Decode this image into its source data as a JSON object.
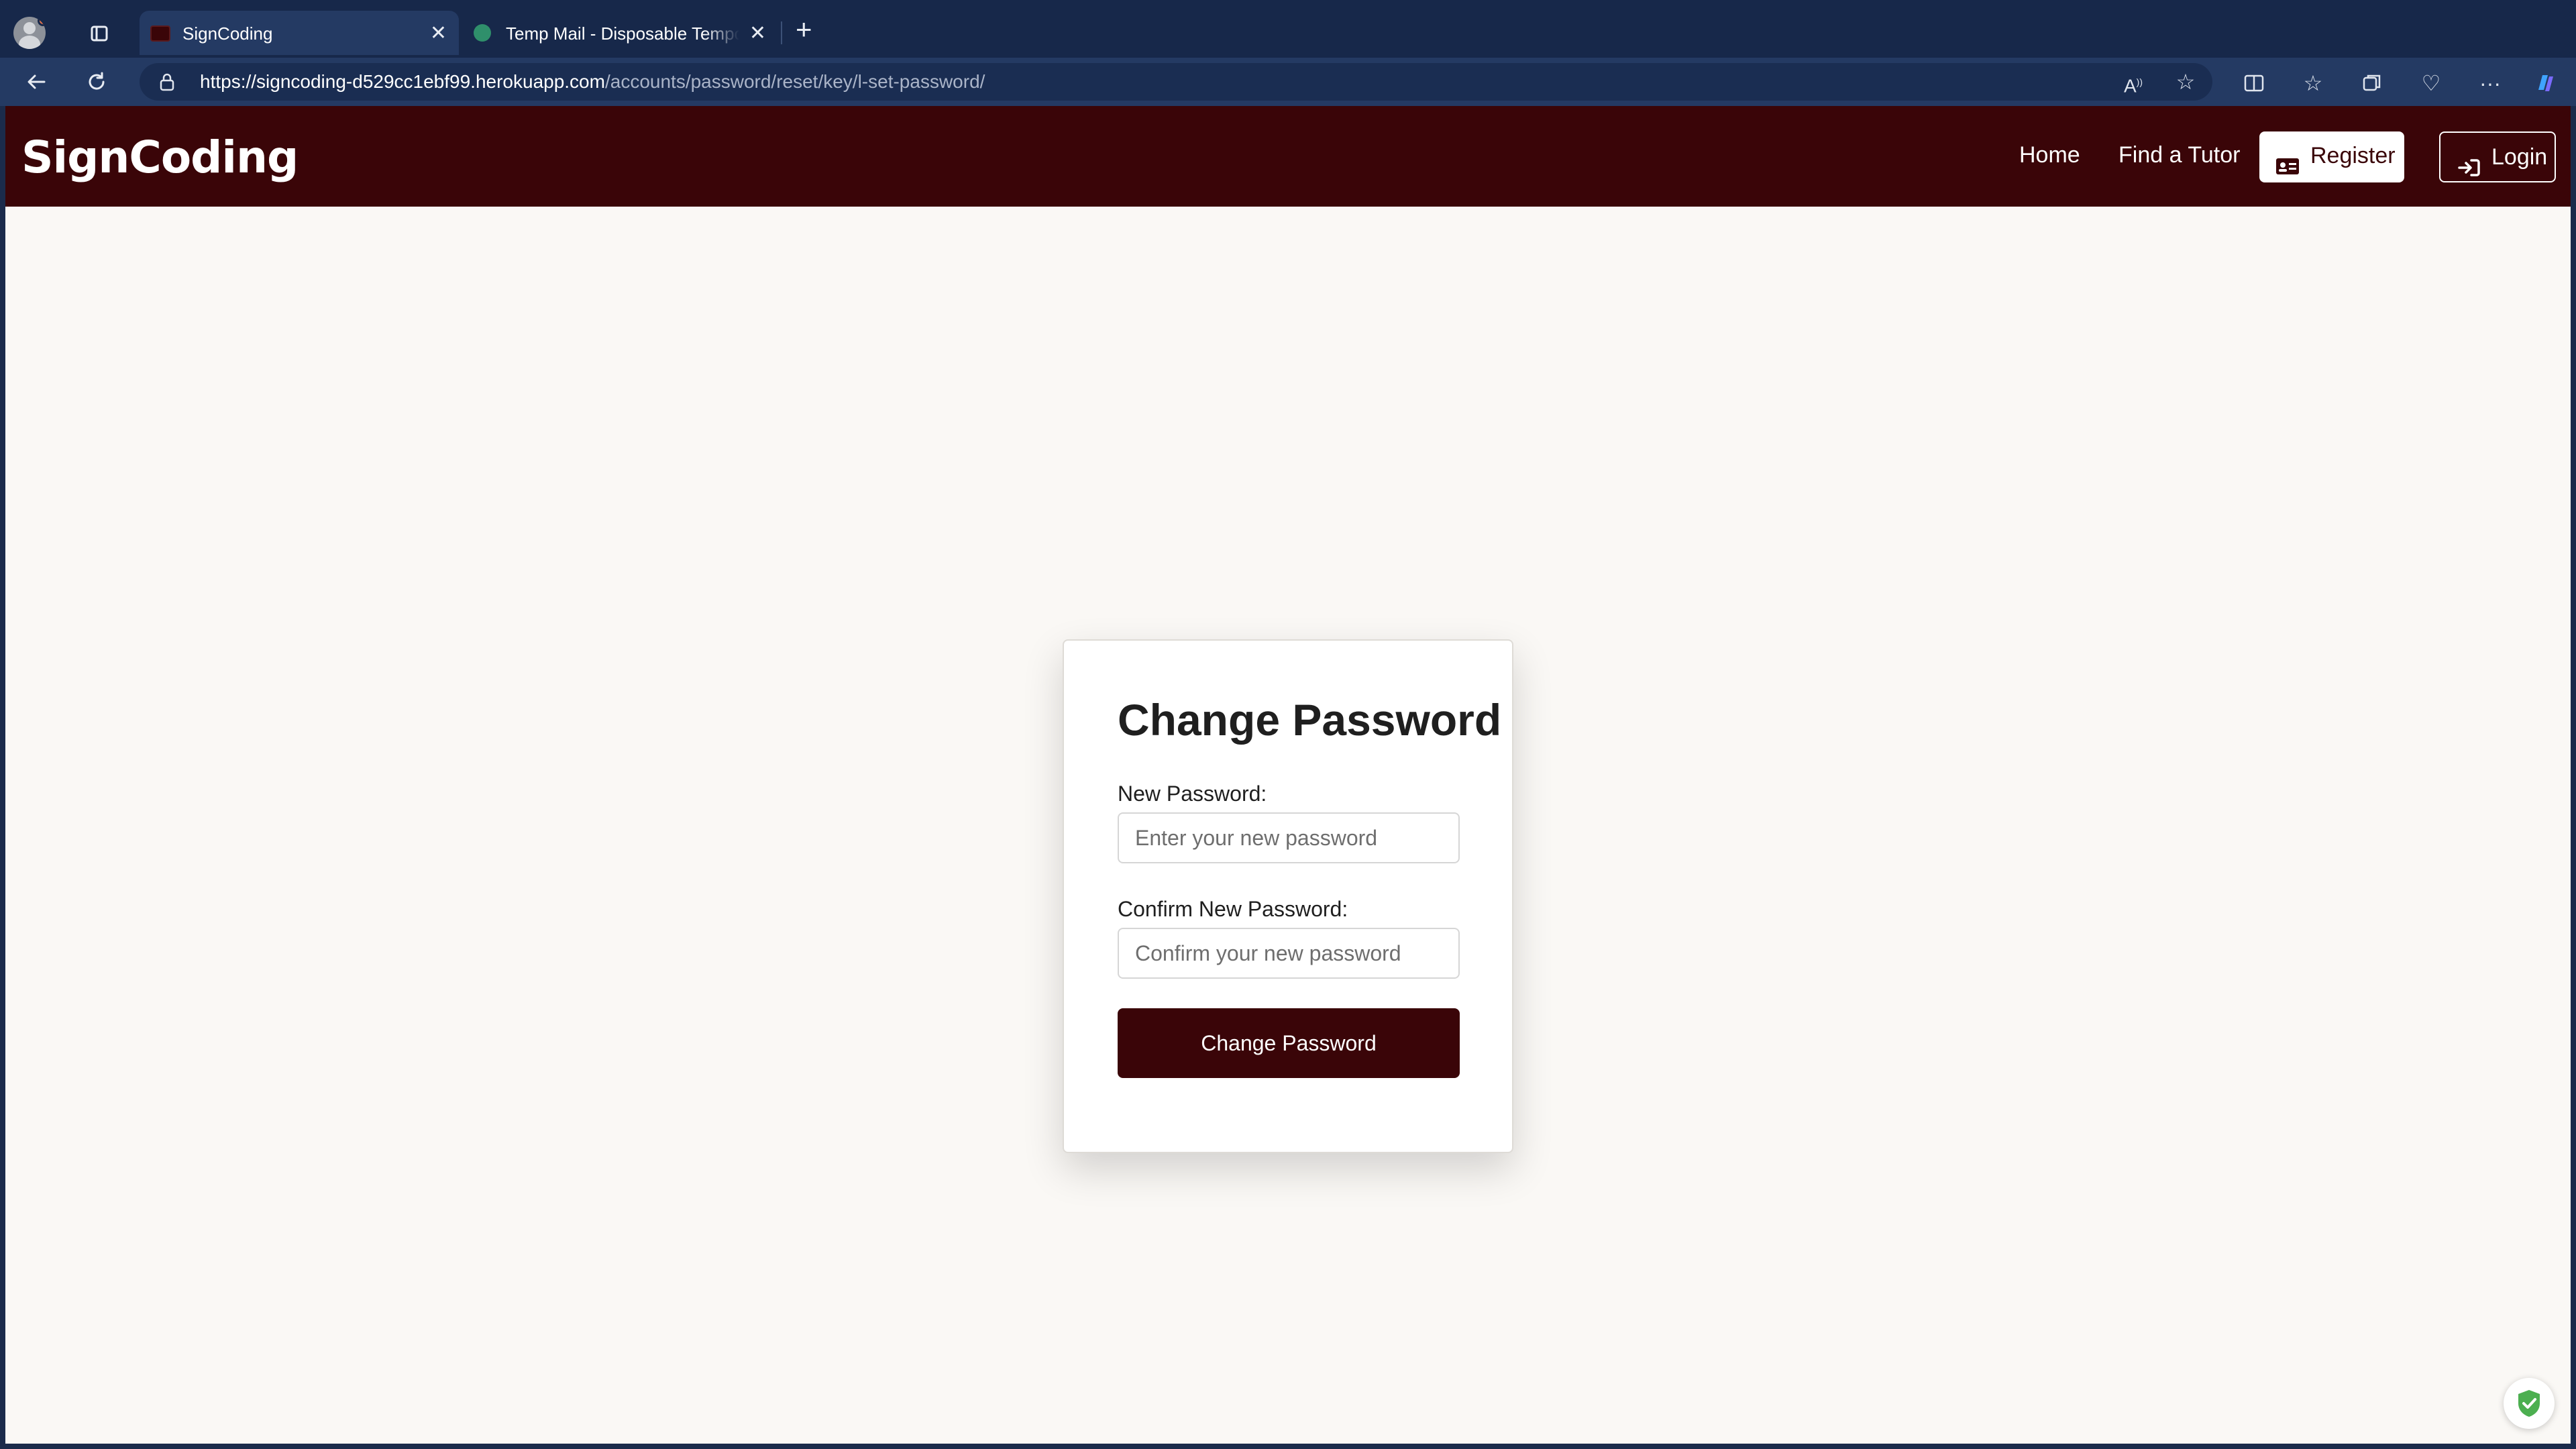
{
  "browser": {
    "tabs": [
      {
        "title": "SignCoding",
        "active": true
      },
      {
        "title": "Temp Mail - Disposable Temporary Email",
        "active": false
      }
    ],
    "url_host": "https://signcoding-d529cc1ebf99.herokuapp.com",
    "url_path": "/accounts/password/reset/key/l-set-password/",
    "colors": {
      "chrome": "#17284a",
      "toolbar": "#243a63"
    }
  },
  "site": {
    "brand": "SignCoding",
    "nav": {
      "home": "Home",
      "find_tutor": "Find a Tutor",
      "register": "Register",
      "login": "Login"
    },
    "colors": {
      "primary": "#3a0508",
      "background": "#faf8f5"
    }
  },
  "form": {
    "title": "Change Password",
    "new_password_label": "New Password:",
    "new_password_placeholder": "Enter your new password",
    "new_password_value": "",
    "confirm_password_label": "Confirm New Password:",
    "confirm_password_placeholder": "Confirm your new password",
    "confirm_password_value": "",
    "submit_label": "Change Password"
  }
}
